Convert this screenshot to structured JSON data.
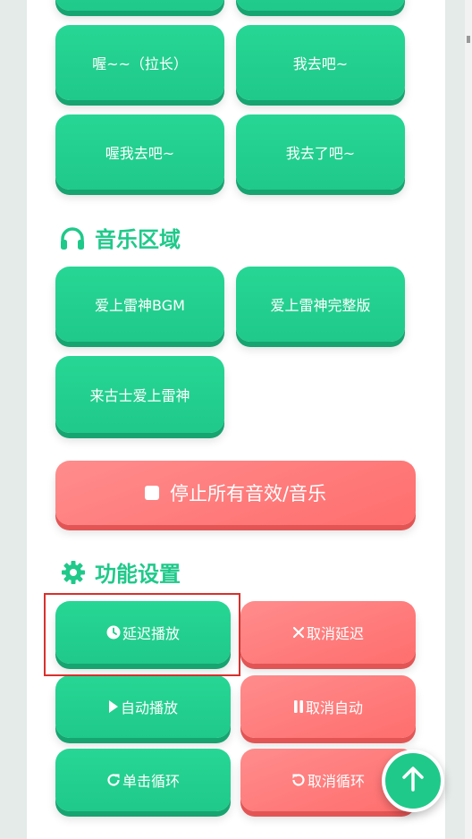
{
  "voice_buttons": {
    "row1": [
      "喔~~（拉长）",
      "我去吧~"
    ],
    "row2": [
      "喔我去吧~",
      "我去了吧~"
    ]
  },
  "music_section": {
    "title": "音乐区域",
    "icon": "headphones-icon",
    "buttons": [
      "爱上雷神BGM",
      "爱上雷神完整版",
      "来古士爱上雷神"
    ]
  },
  "stop_button": {
    "label": "停止所有音效/音乐",
    "icon": "stop-square-icon"
  },
  "settings_section": {
    "title": "功能设置",
    "icon": "gear-icon",
    "delay_play": "延迟播放",
    "cancel_delay": "取消延迟",
    "auto_play": "自动播放",
    "cancel_auto": "取消自动",
    "single_loop": "单击循环",
    "cancel_loop": "取消循环"
  },
  "colors": {
    "green": "#1fc98a",
    "red": "#ff6e6e",
    "highlight": "#d9302c"
  }
}
